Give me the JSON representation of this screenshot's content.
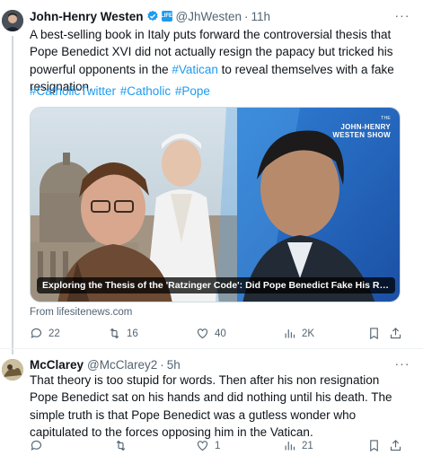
{
  "tweet1": {
    "name": "John-Henry Westen",
    "handle": "@JhWesten",
    "dot": "·",
    "time": "11h",
    "text_before_link": "A best-selling book in Italy puts forward the controversial thesis that Pope Benedict XVI did not actually resign the papacy but tricked his powerful opponents in the ",
    "text_link": "#Vatican",
    "text_after_link": " to reveal themselves with a fake resignation.",
    "hashtags": "#CatholicTwitter #Catholic #Pope",
    "card": {
      "caption": "Exploring the Thesis of the 'Ratzinger Code': Did Pope Benedict Fake His Resign...",
      "show_logo_small": "THE",
      "show_logo_line1": "JOHN-HENRY",
      "show_logo_line2": "WESTEN SHOW",
      "from": "From lifesitenews.com"
    },
    "actions": {
      "replies": "22",
      "retweets": "16",
      "likes": "40",
      "views": "2K"
    }
  },
  "tweet2": {
    "name": "McClarey",
    "handle": "@McClarey2",
    "dot": "·",
    "time": "5h",
    "text": "That theory is too stupid for words.  Then after his non resignation Pope Benedict sat on his hands and did nothing until his death.  The simple truth is that Pope Benedict was a gutless wonder who capitulated to the forces opposing him in the Vatican.",
    "actions": {
      "replies": "",
      "retweets": "",
      "likes": "1",
      "views": "21"
    }
  },
  "colors": {
    "accent": "#1d9bf0",
    "text": "#0f1419",
    "muted": "#536471"
  },
  "icons": [
    "verified-badge-icon",
    "affiliate-badge-icon",
    "more-icon",
    "reply-icon",
    "retweet-icon",
    "like-icon",
    "views-icon",
    "bookmark-icon",
    "share-icon"
  ]
}
